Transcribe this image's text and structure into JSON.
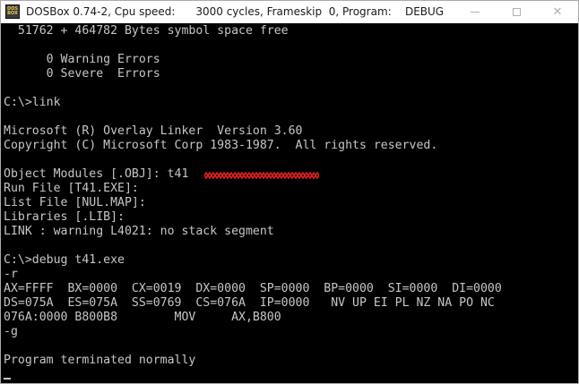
{
  "window": {
    "title": "DOSBox 0.74-2, Cpu speed:      3000 cycles, Frameskip  0, Program:    DEBUG",
    "icon_label_top": "DOS",
    "icon_label_bottom": "BOX",
    "icon_name": "dosbox-app-icon",
    "minimize_icon": "minimize-icon",
    "maximize_icon": "maximize-icon",
    "close_icon": "close-icon",
    "close_glyph": "✕"
  },
  "colors": {
    "terminal_bg": "#000000",
    "terminal_text": "#c6c6c6",
    "annotation_red": "#e02020"
  },
  "terminal": {
    "lines": [
      "  51762 + 464782 Bytes symbol space free",
      "",
      "      0 Warning Errors",
      "      0 Severe  Errors",
      "",
      "C:\\>link",
      "",
      "Microsoft (R) Overlay Linker  Version 3.60",
      "Copyright (C) Microsoft Corp 1983-1987.  All rights reserved.",
      "",
      "Object Modules [.OBJ]: t41",
      "Run File [T41.EXE]:",
      "List File [NUL.MAP]:",
      "Libraries [.LIB]:",
      "LINK : warning L4021: no stack segment",
      "",
      "C:\\>debug t41.exe",
      "-r",
      "AX=FFFF  BX=0000  CX=0019  DX=0000  SP=0000  BP=0000  SI=0000  DI=0000",
      "DS=075A  ES=075A  SS=0769  CS=076A  IP=0000   NV UP EI PL NZ NA PO NC",
      "076A:0000 B800B8        MOV     AX,B800",
      "-g",
      "",
      "Program terminated normally",
      ""
    ]
  }
}
